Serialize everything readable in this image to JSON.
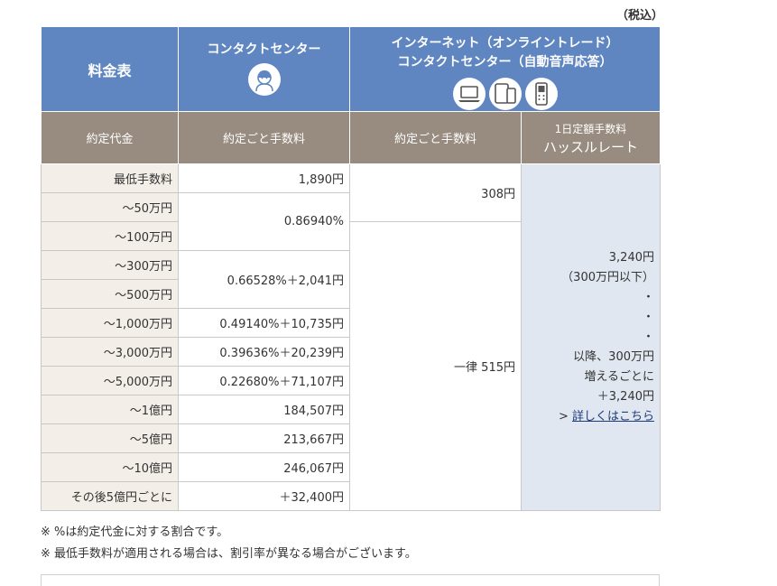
{
  "tax_note": "（税込）",
  "header": {
    "title": "料金表",
    "contact_center": "コンタクトセンター",
    "internet_line1": "インターネット（オンライントレード）",
    "internet_line2": "コンタクトセンター（自動音声応答）"
  },
  "subheader": {
    "amount": "約定代金",
    "per_trade_1": "約定ごと手数料",
    "per_trade_2": "約定ごと手数料",
    "daily_line1": "1日定額手数料",
    "daily_line2": "ハッスルレート"
  },
  "rows": [
    {
      "amount": "最低手数料",
      "contact": "1,890円"
    },
    {
      "amount": "～50万円",
      "contact": "0.86940%"
    },
    {
      "amount": "～100万円"
    },
    {
      "amount": "～300万円",
      "contact": "0.66528%＋2,041円"
    },
    {
      "amount": "～500万円"
    },
    {
      "amount": "～1,000万円",
      "contact": "0.49140%＋10,735円"
    },
    {
      "amount": "～3,000万円",
      "contact": "0.39636%＋20,239円"
    },
    {
      "amount": "～5,000万円",
      "contact": "0.22680%＋71,107円"
    },
    {
      "amount": "～1億円",
      "contact": "184,507円"
    },
    {
      "amount": "～5億円",
      "contact": "213,667円"
    },
    {
      "amount": "～10億円",
      "contact": "246,067円"
    },
    {
      "amount": "その後5億円ごとに",
      "contact": "＋32,400円"
    }
  ],
  "internet": {
    "low": "308円",
    "flat": "一律 515円"
  },
  "hassle": {
    "price": "3,240円",
    "limit": "（300万円以下）",
    "dot1": "・",
    "dot2": "・",
    "dot3": "・",
    "after1": "以降、300万円",
    "after2": "増えるごとに",
    "after3": "＋3,240円",
    "link_arrow": ">",
    "link": "詳しくはこちら"
  },
  "notes": [
    "※ %は約定代金に対する割合です。",
    "※ 最低手数料が適用される場合は、割引率が異なる場合がございます。"
  ],
  "icons": [
    "person-headset-icon",
    "laptop-icon",
    "tablet-phone-icon",
    "mobile-phone-icon"
  ]
}
